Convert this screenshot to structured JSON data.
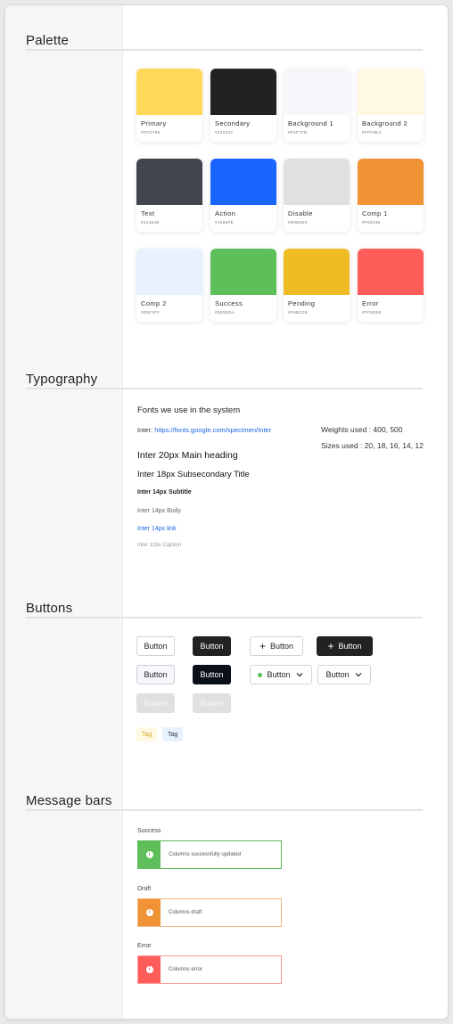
{
  "sections": {
    "palette": "Palette",
    "typography": "Typography",
    "buttons": "Buttons",
    "message_bars": "Message bars"
  },
  "palette": [
    {
      "name": "Primary",
      "hex": "#FFD759",
      "color": "#FFD759"
    },
    {
      "name": "Secondary",
      "hex": "#222222",
      "color": "#222222"
    },
    {
      "name": "Background 1",
      "hex": "#F5F7FB",
      "color": "#F5F7FB"
    },
    {
      "name": "Background 2",
      "hex": "#FFF9E4",
      "color": "#FFF9E4"
    },
    {
      "name": "Text",
      "hex": "#41454E",
      "color": "#41454E"
    },
    {
      "name": "Action",
      "hex": "#1866FE",
      "color": "#1866FE"
    },
    {
      "name": "Disable",
      "hex": "#E0E0E0",
      "color": "#E0E0E0"
    },
    {
      "name": "Comp 1",
      "hex": "#F09336",
      "color": "#F09336"
    },
    {
      "name": "Comp 2",
      "hex": "#E8F2FF",
      "color": "#E8F2FF"
    },
    {
      "name": "Success",
      "hex": "#5EBE5A",
      "color": "#5EBE5A"
    },
    {
      "name": "Pending",
      "hex": "#F0BC25",
      "color": "#F0BC25"
    },
    {
      "name": "Error",
      "hex": "#FF5D59",
      "color": "#FF5D59"
    }
  ],
  "typography": {
    "intro": "Fonts we use in the system",
    "inter_label": "Inter:",
    "inter_link": "https://fonts.google.com/specimen/Inter",
    "weights": "Weights used : 400, 500",
    "sizes": "Sizes used : 20, 18, 16, 14, 12",
    "h20": "Inter 20px Main heading",
    "h18": "Inter 18px Subsecondary Title",
    "h14": "Inter 14px Subtitle",
    "body": "Inter 14px Body",
    "link": "Inter 14px link",
    "caption": "Inter 12px Caption"
  },
  "buttons": {
    "label": "Button",
    "tag_label": "Tag",
    "status_dot_color": "#5EBE5A"
  },
  "message_bars": [
    {
      "label": "Success",
      "text": "Columns successfully updated",
      "color": "#5EBE5A"
    },
    {
      "label": "Draft",
      "text": "Columns draft",
      "color": "#F09336"
    },
    {
      "label": "Error",
      "text": "Columns error",
      "color": "#FF5D59"
    }
  ]
}
